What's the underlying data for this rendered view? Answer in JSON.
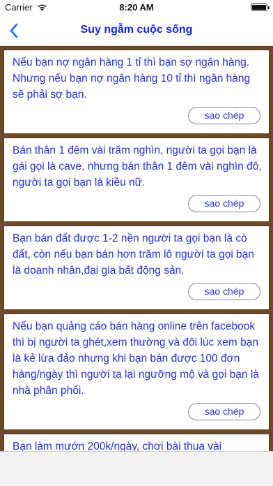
{
  "status": {
    "carrier": "Carrier",
    "time": "8:20 AM"
  },
  "nav": {
    "title": "Suy ngẫm cuộc sống"
  },
  "copy_label": "sao chép",
  "cards": [
    {
      "text": "Nếu bạn nợ ngân hàng 1 tỉ thì bạn sợ ngân hàng. Nhưng nếu bạn nợ ngân hàng 10 tỉ thì ngân hàng sẽ phải sợ bạn."
    },
    {
      "text": "Bán thân 1 đêm vài trăm nghìn, người ta gọi bạn là gái gọi là cave, nhưng bán thân 1 đêm vài nghìn đô, người ta gọi bạn là kiều nữ."
    },
    {
      "text": "Bạn bán đất được 1-2 nền người ta gọi bạn là cò đất, còn nếu bạn bán hơn trăm lô người ta gọi bạn là doanh nhân,đại gia bất động sản."
    },
    {
      "text": "Nếu bạn quảng cáo bán hàng online trên facebook thì bị người ta ghét,xem thường và đôi lúc xem bạn là kẻ lừa đảo nhưng khi bạn bán được 100 đơn hàng/ngày thì người ta lại ngưỡng mộ và gọi bạn là nhà phân phối."
    },
    {
      "text": "Bạn làm mướn 200k/ngày, chơi bài thua vài"
    }
  ]
}
